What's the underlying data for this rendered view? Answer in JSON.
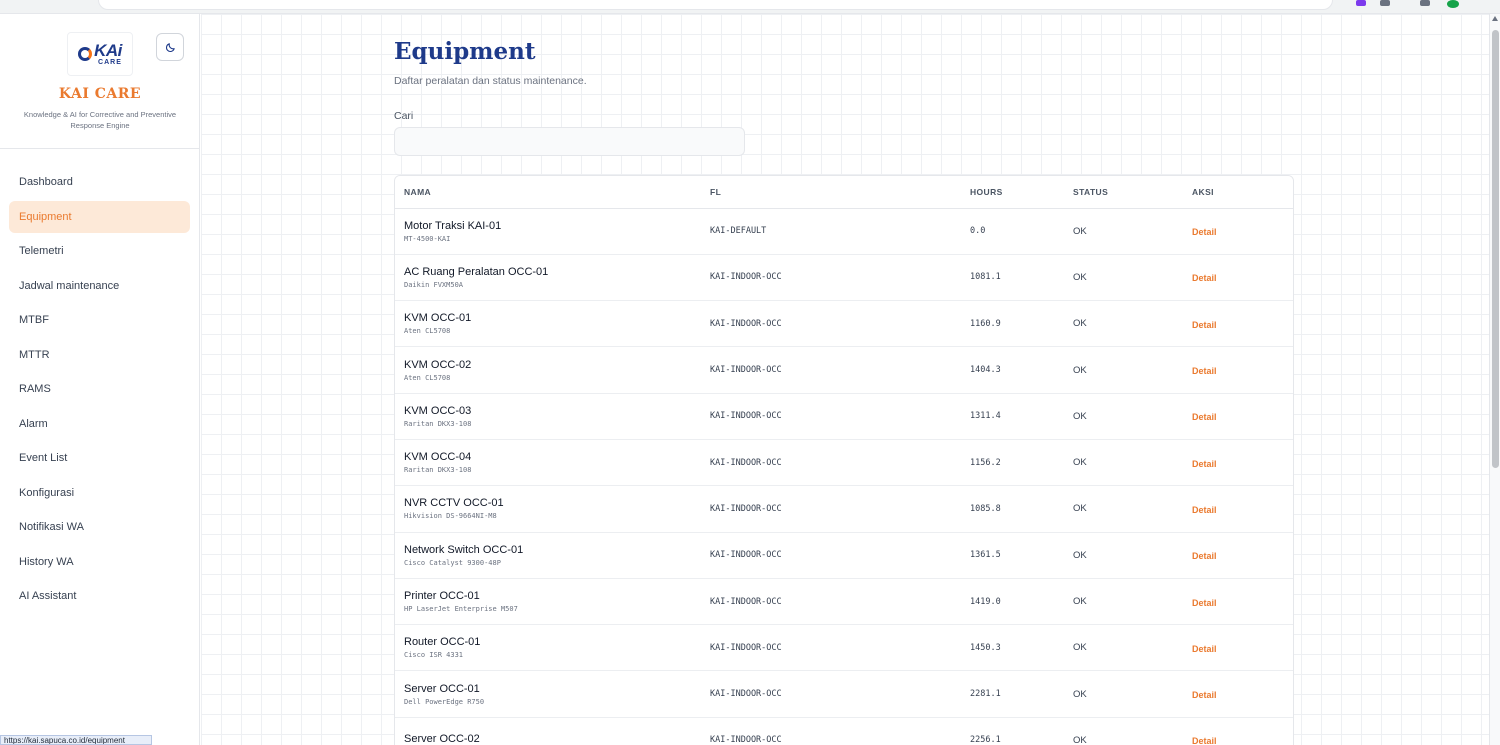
{
  "app": {
    "name": "KAI CARE",
    "tagline": "Knowledge & AI for Corrective and Preventive Response Engine",
    "logo_text": "KAi",
    "logo_sub": "CARE",
    "theme_icon": "moon-icon"
  },
  "status_bar": {
    "url": "https://kai.sapuca.co.id/equipment"
  },
  "sidebar": {
    "items": [
      {
        "label": "Dashboard",
        "active": false
      },
      {
        "label": "Equipment",
        "active": true
      },
      {
        "label": "Telemetri",
        "active": false
      },
      {
        "label": "Jadwal maintenance",
        "active": false
      },
      {
        "label": "MTBF",
        "active": false
      },
      {
        "label": "MTTR",
        "active": false
      },
      {
        "label": "RAMS",
        "active": false
      },
      {
        "label": "Alarm",
        "active": false
      },
      {
        "label": "Event List",
        "active": false
      },
      {
        "label": "Konfigurasi",
        "active": false
      },
      {
        "label": "Notifikasi WA",
        "active": false
      },
      {
        "label": "History WA",
        "active": false
      },
      {
        "label": "AI Assistant",
        "active": false
      }
    ]
  },
  "page": {
    "title": "Equipment",
    "subtitle": "Daftar peralatan dan status maintenance.",
    "search_label": "Cari",
    "search_value": "",
    "search_placeholder": ""
  },
  "table": {
    "headers": {
      "name": "NAMA",
      "fl": "FL",
      "hours": "HOURS",
      "status": "STATUS",
      "action": "AKSI"
    },
    "action_label": "Detail",
    "rows": [
      {
        "name": "Motor Traksi KAI-01",
        "model": "MT-4500-KAI",
        "fl": "KAI-DEFAULT",
        "hours": "0.0",
        "status": "OK"
      },
      {
        "name": "AC Ruang Peralatan OCC-01",
        "model": "Daikin FVXM50A",
        "fl": "KAI-INDOOR-OCC",
        "hours": "1081.1",
        "status": "OK"
      },
      {
        "name": "KVM OCC-01",
        "model": "Aten CL5708",
        "fl": "KAI-INDOOR-OCC",
        "hours": "1160.9",
        "status": "OK"
      },
      {
        "name": "KVM OCC-02",
        "model": "Aten CL5708",
        "fl": "KAI-INDOOR-OCC",
        "hours": "1404.3",
        "status": "OK"
      },
      {
        "name": "KVM OCC-03",
        "model": "Raritan DKX3-108",
        "fl": "KAI-INDOOR-OCC",
        "hours": "1311.4",
        "status": "OK"
      },
      {
        "name": "KVM OCC-04",
        "model": "Raritan DKX3-108",
        "fl": "KAI-INDOOR-OCC",
        "hours": "1156.2",
        "status": "OK"
      },
      {
        "name": "NVR CCTV OCC-01",
        "model": "Hikvision DS-9664NI-M8",
        "fl": "KAI-INDOOR-OCC",
        "hours": "1085.8",
        "status": "OK"
      },
      {
        "name": "Network Switch OCC-01",
        "model": "Cisco Catalyst 9300-48P",
        "fl": "KAI-INDOOR-OCC",
        "hours": "1361.5",
        "status": "OK"
      },
      {
        "name": "Printer OCC-01",
        "model": "HP LaserJet Enterprise M507",
        "fl": "KAI-INDOOR-OCC",
        "hours": "1419.0",
        "status": "OK"
      },
      {
        "name": "Router OCC-01",
        "model": "Cisco ISR 4331",
        "fl": "KAI-INDOOR-OCC",
        "hours": "1450.3",
        "status": "OK"
      },
      {
        "name": "Server OCC-01",
        "model": "Dell PowerEdge R750",
        "fl": "KAI-INDOOR-OCC",
        "hours": "2281.1",
        "status": "OK"
      },
      {
        "name": "Server OCC-02",
        "model": "",
        "fl": "KAI-INDOOR-OCC",
        "hours": "2256.1",
        "status": "OK"
      }
    ]
  },
  "colors": {
    "accent": "#ea7a2f",
    "accent_bg": "#fde9d8",
    "title": "#1e3a8a"
  }
}
